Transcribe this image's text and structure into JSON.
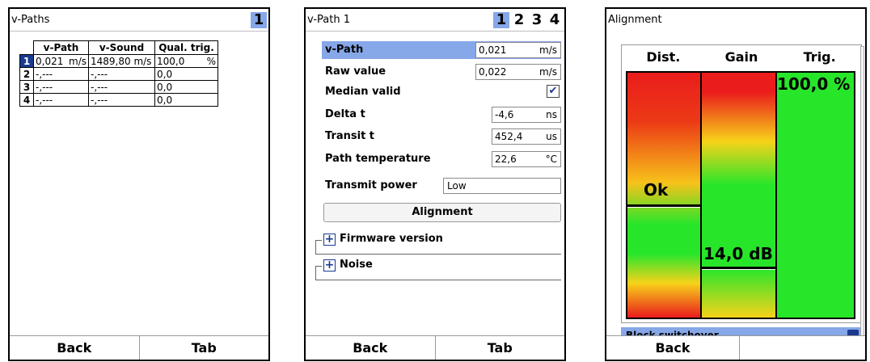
{
  "panel1": {
    "title": "v-Paths",
    "page": "1",
    "columns": [
      "v-Path",
      "v-Sound",
      "Qual. trig."
    ],
    "rows": [
      {
        "num": "1",
        "vpath": "0,021",
        "vpath_unit": "m/s",
        "vsound": "1489,80 m/s",
        "qual": "100,0",
        "qual_unit": "%"
      },
      {
        "num": "2",
        "vpath": "-,---",
        "vpath_unit": "",
        "vsound": "-,---",
        "qual": "0,0",
        "qual_unit": ""
      },
      {
        "num": "3",
        "vpath": "-,---",
        "vpath_unit": "",
        "vsound": "-,---",
        "qual": "0,0",
        "qual_unit": ""
      },
      {
        "num": "4",
        "vpath": "-,---",
        "vpath_unit": "",
        "vsound": "-,---",
        "qual": "0,0",
        "qual_unit": ""
      }
    ],
    "softkeys": {
      "left": "Back",
      "right": "Tab"
    }
  },
  "panel2": {
    "title": "v-Path 1",
    "pages": [
      "1",
      "2",
      "3",
      "4"
    ],
    "params": {
      "vpath": {
        "label": "v-Path",
        "value": "0,021",
        "unit": "m/s"
      },
      "raw": {
        "label": "Raw value",
        "value": "0,022",
        "unit": "m/s"
      },
      "median": {
        "label": "Median valid",
        "check": "✔"
      },
      "delta": {
        "label": "Delta t",
        "value": "-4,6",
        "unit": "ns"
      },
      "transit": {
        "label": "Transit t",
        "value": "452,4",
        "unit": "us"
      },
      "temp": {
        "label": "Path temperature",
        "value": "22,6",
        "unit": "°C"
      },
      "power": {
        "label": "Transmit power",
        "value": "Low"
      }
    },
    "alignment_button": "Alignment",
    "groups": {
      "firmware": "Firmware version",
      "noise": "Noise",
      "plus": "+"
    },
    "softkeys": {
      "left": "Back",
      "right": "Tab"
    }
  },
  "panel3": {
    "title": "Alignment",
    "columns": {
      "dist": "Dist.",
      "gain": "Gain",
      "trig": "Trig."
    },
    "dist_value": "Ok",
    "gain_value": "14,0 dB",
    "trig_value": "100,0 %",
    "block_label": "Block switchover",
    "softkeys": {
      "left": "Back",
      "right": ""
    }
  }
}
